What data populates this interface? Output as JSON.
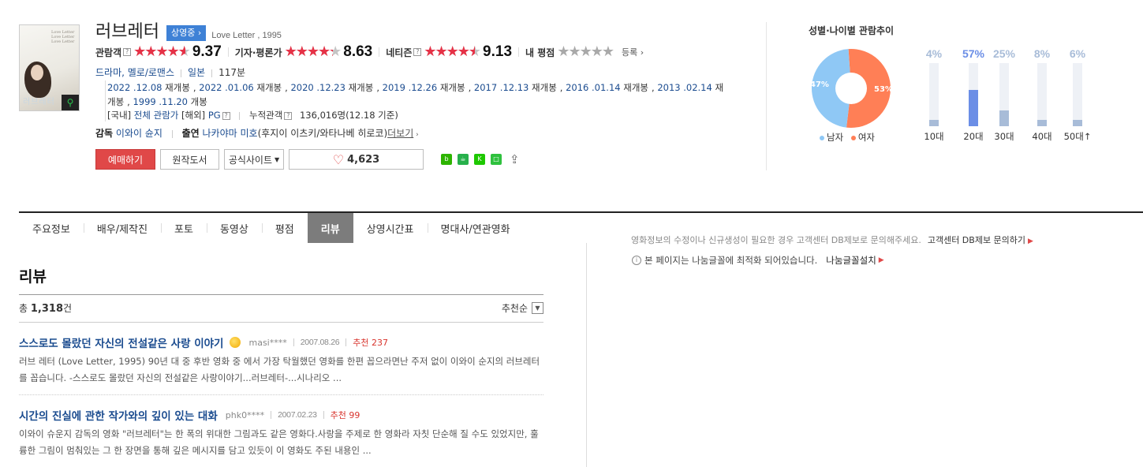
{
  "movie": {
    "poster_title": "러브레터",
    "poster_script": "Love Letter Love Letter Love Letter",
    "title": "러브레터",
    "status_badge": "상영중",
    "eng_title": "Love Letter , 1995",
    "ratings": [
      {
        "label": "관람객",
        "score": "9.37",
        "fill_fraction": 0.937
      },
      {
        "label": "기자·평론가",
        "score": "8.63",
        "fill_fraction": 0.863
      },
      {
        "label": "네티즌",
        "score": "9.13",
        "fill_fraction": 0.913
      }
    ],
    "my_rating_label": "내 평점",
    "my_rating_register": "등록",
    "genre": "드라마, 멜로/로맨스",
    "country": "일본",
    "runtime": "117분",
    "releases": [
      {
        "date": "2022 .12.08",
        "label": "재개봉"
      },
      {
        "date": "2022 .01.06",
        "label": "재개봉"
      },
      {
        "date": "2020 .12.23",
        "label": "재개봉"
      },
      {
        "date": "2019 .12.26",
        "label": "재개봉"
      },
      {
        "date": "2017 .12.13",
        "label": "재개봉"
      },
      {
        "date": "2016 .01.14",
        "label": "재개봉"
      },
      {
        "date": "2013 .02.14",
        "label": "재개봉"
      },
      {
        "date": "1999 .11.20",
        "label": "개봉"
      }
    ],
    "grade_domestic_label": "[국내]",
    "grade_domestic": "전체 관람가",
    "grade_foreign_label": "[해외]",
    "grade_foreign": "PG",
    "audience_label": "누적관객",
    "audience_count": "136,016명",
    "audience_date": "(12.18 기준)",
    "director_label": "감독",
    "director": "이와이 슌지",
    "cast_label": "출연",
    "cast_lead": "나카야마 미호",
    "cast_rest": "(후지이 이츠키/와타나베 히로코)",
    "more_label": "더보기"
  },
  "actions": {
    "book": "예매하기",
    "original_book": "원작도서",
    "official_site": "공식사이트",
    "likes": "4,623"
  },
  "demographics": {
    "title": "성별·나이별 관람추이",
    "male_label": "남자",
    "female_label": "여자",
    "male_pct": "47%",
    "female_pct": "53%",
    "male_value": 47,
    "female_value": 53,
    "male_color": "#8fc8f5",
    "female_color": "#ff7f56",
    "age_groups": [
      {
        "label": "10대",
        "pct": "4%",
        "value": 4
      },
      {
        "label": "20대",
        "pct": "57%",
        "value": 57,
        "highlight": true
      },
      {
        "label": "30대",
        "pct": "25%",
        "value": 25
      },
      {
        "label": "40대",
        "pct": "8%",
        "value": 8
      },
      {
        "label": "50대↑",
        "pct": "6%",
        "value": 6
      }
    ],
    "highlight_color": "#6b8ee6",
    "bar_color": "#a8bcd8"
  },
  "tabs": [
    "주요정보",
    "배우/제작진",
    "포토",
    "동영상",
    "평점",
    "리뷰",
    "상영시간표",
    "명대사/연관영화"
  ],
  "active_tab": "리뷰",
  "notices": {
    "db_text": "영화정보의 수정이나 신규생성이 필요한 경우 고객센터 DB제보로 문의해주세요.",
    "db_link": "고객센터 DB제보 문의하기",
    "font_text": "본 페이지는 나눔글꼴에 최적화 되어있습니다.",
    "font_link": "나눔글꼴설치"
  },
  "reviews": {
    "heading": "리뷰",
    "total_prefix": "총",
    "total_count": "1,318",
    "total_suffix": "건",
    "sort_label": "추천순",
    "items": [
      {
        "title": "스스로도 몰랐던 자신의 전설같은 사랑 이야기",
        "user": "masi****",
        "date": "2007.08.26",
        "rec": "추천 237",
        "body": "러브 레터 (Love Letter, 1995) 90년 대 중 후반 영화 중 에서 가장 탁월했던 영화를 한편 꼽으라면난 주저 없이 이와이 순지의 러브레터를 꼽습니다. -스스로도 몰랐던 자신의 전설같은 사랑이야기...러브레터-...시나리오 ..."
      },
      {
        "title": "시간의 진실에 관한 작가와의 깊이 있는 대화",
        "user": "phk0****",
        "date": "2007.02.23",
        "rec": "추천 99",
        "body": "이와이 슈운지 감독의 영화 \"러브레터\"는 한 폭의 위대한 그림과도 같은 영화다.사랑을 주제로 한 영화라 자칫 단순해 질 수도 있었지만, 훌륭한 그림이 멈춰있는 그 한 장면을 통해 깊은 메시지를 담고 있듯이 이 영화도 주된 내용인 ..."
      }
    ]
  }
}
